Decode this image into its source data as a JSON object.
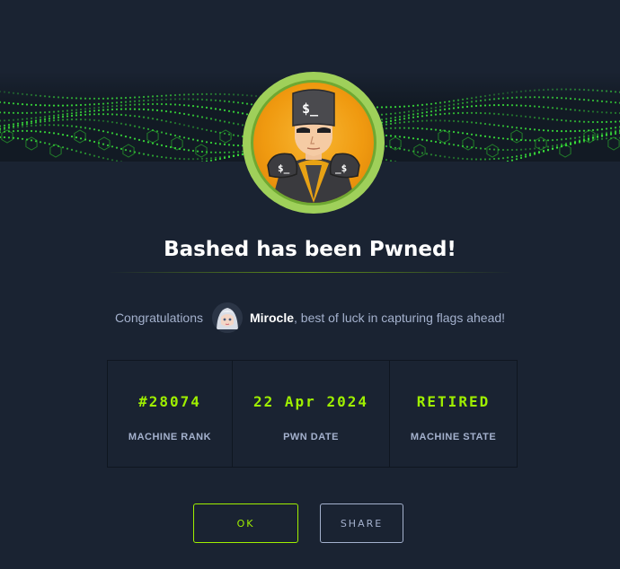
{
  "title": "Bashed has been Pwned!",
  "congrats": {
    "prefix": "Congratulations",
    "username": "Mirocle",
    "suffix": ", best of luck in capturing flags ahead!"
  },
  "stats": [
    {
      "value": "#28074",
      "label": "MACHINE RANK"
    },
    {
      "value": "22 Apr 2024",
      "label": "PWN DATE"
    },
    {
      "value": "RETIRED",
      "label": "MACHINE STATE"
    }
  ],
  "buttons": {
    "ok": "OK",
    "share": "SHARE"
  },
  "colors": {
    "background": "#1a2332",
    "accent": "#9fef00",
    "muted": "#a4b1cd"
  },
  "icons": {
    "banner": "green-digital-wave-banner",
    "machine_avatar": "bashed-machine-avatar",
    "user_avatar": "user-avatar"
  }
}
